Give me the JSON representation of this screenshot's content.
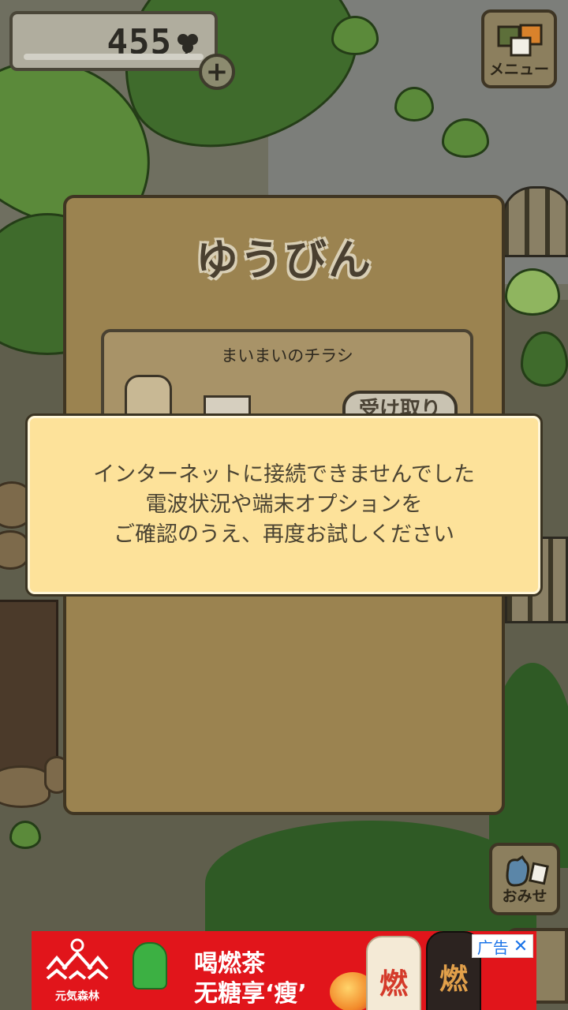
{
  "hud": {
    "clover_count": "455",
    "add_label": "+",
    "menu_label": "メニュー",
    "shop_label": "おみせ"
  },
  "mail": {
    "title": "ゆうびん",
    "item_title": "まいまいのチラシ",
    "receive_label": "受け取り"
  },
  "error": {
    "line1": "インターネットに接続できませんでした",
    "line2": "電波状況や端末オプションを",
    "line3": "ご確認のうえ、再度お試しください"
  },
  "ad": {
    "brand": "元気森林",
    "line1": "喝燃茶",
    "line2": "无糖享‘瘦’",
    "bottle1_glyph": "燃",
    "bottle2_glyph": "燃",
    "tag": "广告",
    "close_icon": "close-icon"
  },
  "colors": {
    "dialog_bg": "#fde29a",
    "panel_bg": "#9b8350",
    "ad_bg": "#e1151b"
  }
}
